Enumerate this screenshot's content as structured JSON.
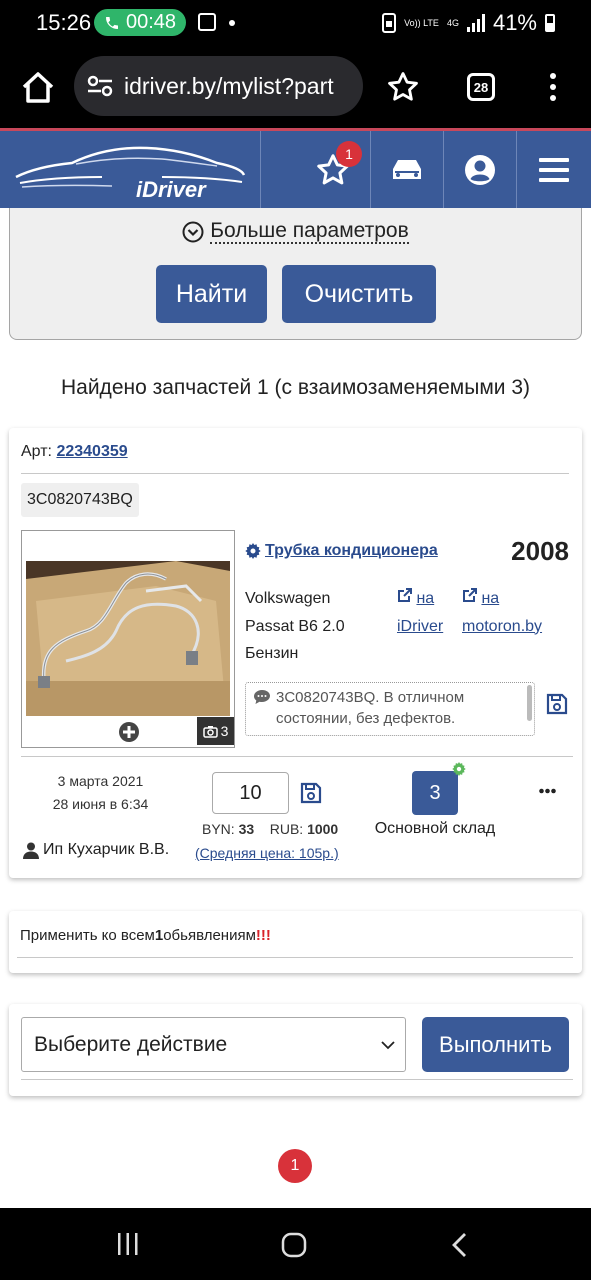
{
  "status_bar": {
    "time": "15:26",
    "call_timer": "00:48",
    "volte": "Vo)) LTE",
    "network": "4G",
    "battery": "41%"
  },
  "browser": {
    "url": "idriver.by/mylist?part",
    "tab_count": "28"
  },
  "site_header": {
    "logo_text": "iDriver",
    "favorites_count": "1",
    "icons": [
      "star-icon",
      "car-icon",
      "user-icon",
      "hamburger-icon"
    ]
  },
  "filter": {
    "more_params_label": "Больше параметров",
    "find_label": "Найти",
    "clear_label": "Очистить"
  },
  "results": {
    "found_text": "Найдено запчастей 1 (с взаимозаменяемыми 3)"
  },
  "part": {
    "art_label": "Арт:",
    "art_number": "22340359",
    "oem": "3C0820743BQ",
    "name": "Трубка кондиционера",
    "year": "2008",
    "make": "Volkswagen",
    "model": "Passat B6 2.0",
    "fuel": "Бензин",
    "link_idriver_top": "на",
    "link_idriver_bottom": "iDriver",
    "link_motoron_top": "на",
    "link_motoron_bottom": "motoron.by",
    "photo_count": "3",
    "note": "3C0820743BQ. В отличном состоянии, без дефектов.",
    "date_created": "3 марта 2021",
    "date_updated": "28 июня в 6:34",
    "seller": "Ип Кухарчик В.В.",
    "quantity": "10",
    "price_byn_label": "BYN:",
    "price_byn": "33",
    "price_rub_label": "RUB:",
    "price_rub": "1000",
    "avg_price": "(Средняя цена: 105р.)",
    "stock": "3",
    "warehouse": "Основной склад"
  },
  "apply_all": {
    "prefix": "Применить ко всем",
    "count": "1",
    "suffix": "обьявлениям",
    "marks": "!!!"
  },
  "action": {
    "select_placeholder": "Выберите действие",
    "execute_label": "Выполнить"
  },
  "pagination": {
    "current_page": "1"
  },
  "colors": {
    "brand": "#3a5a98",
    "accent_red": "#d8323a",
    "link": "#2a4b8d"
  }
}
